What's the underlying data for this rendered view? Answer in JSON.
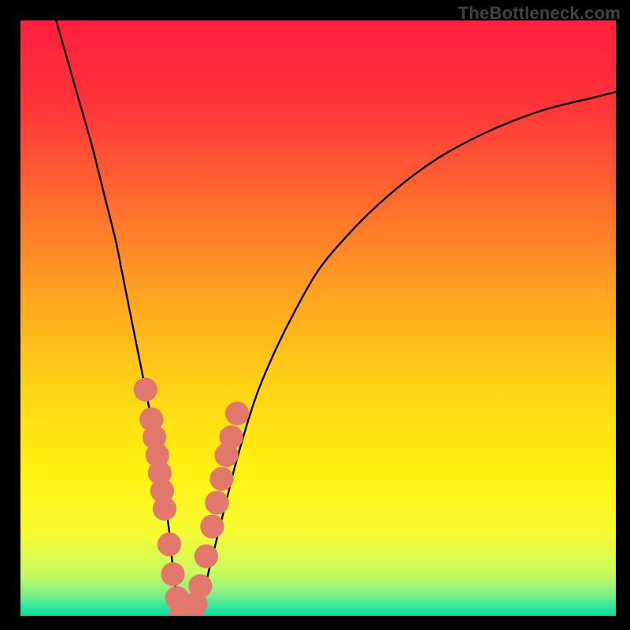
{
  "watermark": "TheBottleneck.com",
  "chart_data": {
    "type": "line",
    "title": "",
    "xlabel": "",
    "ylabel": "",
    "xlim": [
      0,
      100
    ],
    "ylim": [
      0,
      100
    ],
    "background_gradient": [
      {
        "offset": 0.0,
        "color": "#ff1f3e"
      },
      {
        "offset": 0.14,
        "color": "#ff343a"
      },
      {
        "offset": 0.3,
        "color": "#ff6a2f"
      },
      {
        "offset": 0.46,
        "color": "#ffa321"
      },
      {
        "offset": 0.62,
        "color": "#ffd516"
      },
      {
        "offset": 0.76,
        "color": "#fff210"
      },
      {
        "offset": 0.86,
        "color": "#f8fb34"
      },
      {
        "offset": 0.93,
        "color": "#c7f95f"
      },
      {
        "offset": 0.965,
        "color": "#7df089"
      },
      {
        "offset": 0.985,
        "color": "#2fe79d"
      },
      {
        "offset": 1.0,
        "color": "#04dd9c"
      }
    ],
    "series": [
      {
        "name": "bottleneck-curve",
        "color": "#000000",
        "x": [
          6,
          8,
          10,
          12,
          14,
          16,
          17,
          18,
          19,
          20,
          21,
          22,
          23,
          24,
          24.5,
          25,
          25.5,
          26,
          26.5,
          27,
          27.5,
          28,
          29,
          30,
          31,
          32,
          33,
          34,
          35,
          36,
          38,
          40,
          43,
          46,
          50,
          55,
          60,
          66,
          72,
          80,
          88,
          96,
          100
        ],
        "y": [
          100,
          93,
          86,
          79,
          71,
          63,
          58,
          53,
          48,
          43,
          38,
          33,
          28,
          22,
          18,
          14,
          9,
          5,
          2,
          0.5,
          0,
          0,
          0.5,
          2,
          5,
          9,
          13,
          17,
          21,
          25,
          32,
          38,
          45,
          51,
          58,
          64,
          69,
          74,
          78,
          82,
          85,
          87,
          88
        ]
      }
    ],
    "markers": {
      "color": "#e2786b",
      "radius": 2.0,
      "points": [
        {
          "x": 21.0,
          "y": 38
        },
        {
          "x": 22.0,
          "y": 33
        },
        {
          "x": 22.5,
          "y": 30
        },
        {
          "x": 23.0,
          "y": 27
        },
        {
          "x": 23.4,
          "y": 24
        },
        {
          "x": 23.8,
          "y": 21
        },
        {
          "x": 24.2,
          "y": 18
        },
        {
          "x": 25.0,
          "y": 12
        },
        {
          "x": 25.6,
          "y": 7
        },
        {
          "x": 26.3,
          "y": 3
        },
        {
          "x": 27.0,
          "y": 0.5
        },
        {
          "x": 27.6,
          "y": 0
        },
        {
          "x": 28.2,
          "y": 0
        },
        {
          "x": 28.8,
          "y": 0.5
        },
        {
          "x": 29.4,
          "y": 2
        },
        {
          "x": 30.2,
          "y": 5
        },
        {
          "x": 31.2,
          "y": 10
        },
        {
          "x": 32.2,
          "y": 15
        },
        {
          "x": 33.0,
          "y": 19
        },
        {
          "x": 33.8,
          "y": 23
        },
        {
          "x": 34.6,
          "y": 27
        },
        {
          "x": 35.4,
          "y": 30
        },
        {
          "x": 36.4,
          "y": 34
        }
      ]
    }
  }
}
